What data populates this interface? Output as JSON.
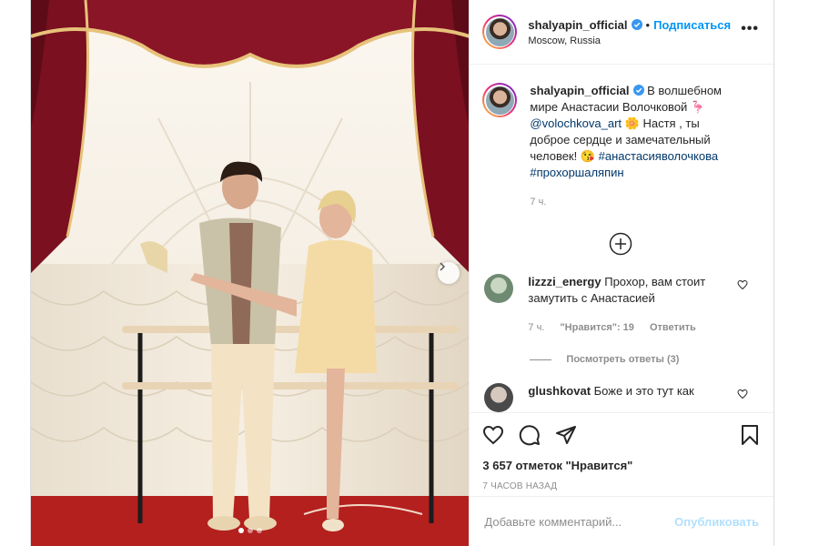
{
  "post": {
    "username": "shalyapin_official",
    "separator": "•",
    "follow_label": "Подписаться",
    "location": "Moscow, Russia",
    "more_label": "•••",
    "caption": {
      "username": "shalyapin_official",
      "text_1": " В волшебном мире Анастасии Волочковой 🦩",
      "mention": "@volochkova_art",
      "text_2": " 🌼 Настя , ты доброе сердце и замечательный человек! 😘 ",
      "hashtag_1": "#анастасияволочкова",
      "hashtag_2": "#прохоршаляпин",
      "time": "7 ч."
    },
    "comments": [
      {
        "username": "lizzzi_energy",
        "text": " Прохор, вам стоит замутить с Анастасией",
        "time": "7 ч.",
        "likes": "\"Нравится\": 19",
        "reply_label": "Ответить",
        "view_replies": "Посмотреть ответы (3)"
      },
      {
        "username": "glushkovat",
        "text": " Боже и это тут как"
      }
    ],
    "likes_text": "3 657 отметок \"Нравится\"",
    "time_ago": "7 часов назад",
    "comment_placeholder": "Добавьте комментарий...",
    "publish_label": "Опубликовать",
    "photo_dots": 3,
    "photo_active_dot": 1
  },
  "colors": {
    "accent": "#0095f6",
    "publish_disabled": "#b2dffc",
    "secondary_text": "#8e8e8e",
    "link": "#00376b",
    "curtain": "#8a1526"
  }
}
